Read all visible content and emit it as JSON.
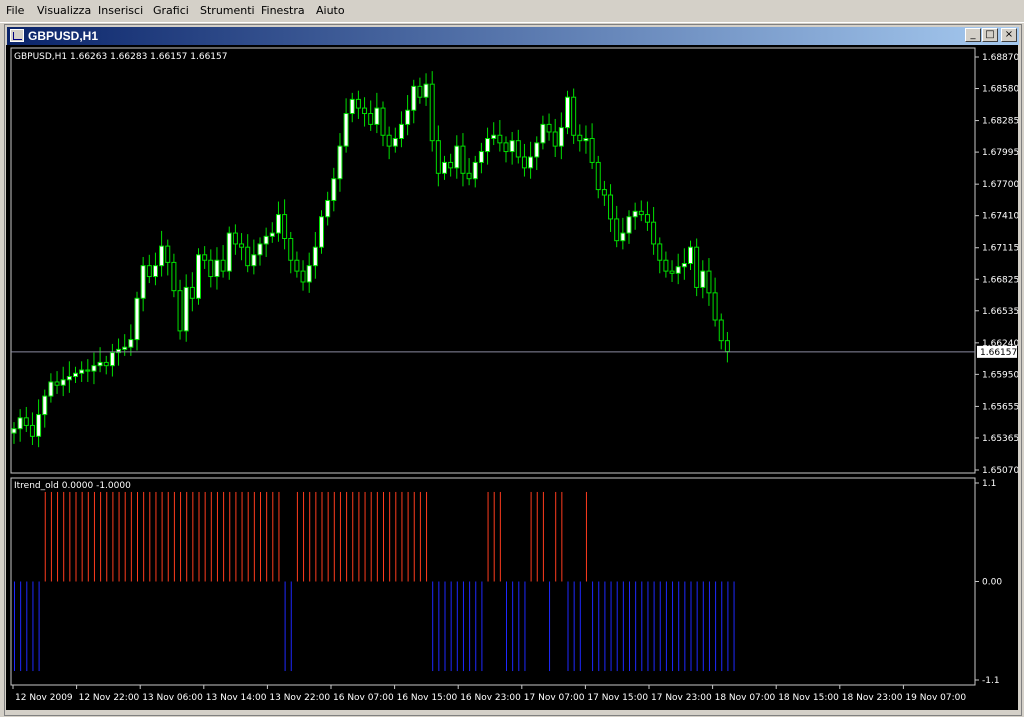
{
  "menu": {
    "items": [
      {
        "label": "File"
      },
      {
        "label": "Visualizza"
      },
      {
        "label": "Inserisci"
      },
      {
        "label": "Grafici"
      },
      {
        "label": "Strumenti"
      },
      {
        "label": "Finestra"
      },
      {
        "label": "Aiuto"
      }
    ]
  },
  "window": {
    "title": "GBPUSD,H1",
    "minimize": "_",
    "maximize": "□",
    "close": "×"
  },
  "colors": {
    "background": "#000000",
    "candle_bull": "#ffffff",
    "candle_bear": "#000000",
    "wick": "#00e000",
    "grid_line": "#c8c8c8",
    "indicator_up": "#ff3c1e",
    "indicator_down": "#1e28ff"
  },
  "chart_data": [
    {
      "type": "candlestick",
      "title": "GBPUSD,H1  1.66263 1.66283 1.66157 1.66157",
      "symbol": "GBPUSD",
      "timeframe": "H1",
      "ohlc_last": {
        "open": 1.66263,
        "high": 1.66283,
        "low": 1.66157,
        "close": 1.66157
      },
      "current_price_label": "1.66157",
      "current_price": 1.66157,
      "ylim": [
        1.6507,
        1.6887
      ],
      "y_ticks": [
        "1.68870",
        "1.68580",
        "1.68285",
        "1.67995",
        "1.67700",
        "1.67410",
        "1.67115",
        "1.66825",
        "1.66535",
        "1.66240",
        "1.65950",
        "1.65655",
        "1.65365",
        "1.65070"
      ],
      "x_ticks": [
        "12 Nov 2009",
        "12 Nov 22:00",
        "13 Nov 06:00",
        "13 Nov 14:00",
        "13 Nov 22:00",
        "16 Nov 07:00",
        "16 Nov 15:00",
        "16 Nov 23:00",
        "17 Nov 07:00",
        "17 Nov 15:00",
        "17 Nov 23:00",
        "18 Nov 07:00",
        "18 Nov 15:00",
        "18 Nov 23:00",
        "19 Nov 07:00"
      ],
      "close": [
        1.6545,
        1.6555,
        1.6548,
        1.6538,
        1.6558,
        1.6575,
        1.6588,
        1.6585,
        1.659,
        1.6593,
        1.6596,
        1.6599,
        1.6598,
        1.6603,
        1.6606,
        1.6603,
        1.6615,
        1.6618,
        1.662,
        1.6627,
        1.6665,
        1.6695,
        1.6685,
        1.6695,
        1.6713,
        1.6698,
        1.6672,
        1.6635,
        1.6675,
        1.6665,
        1.6705,
        1.67,
        1.6685,
        1.67,
        1.669,
        1.6725,
        1.6715,
        1.6712,
        1.6695,
        1.6705,
        1.6715,
        1.6722,
        1.6725,
        1.6742,
        1.672,
        1.67,
        1.669,
        1.668,
        1.6695,
        1.6712,
        1.674,
        1.6755,
        1.6775,
        1.6805,
        1.6835,
        1.6848,
        1.684,
        1.6835,
        1.6825,
        1.684,
        1.6815,
        1.6805,
        1.6812,
        1.6825,
        1.6838,
        1.686,
        1.685,
        1.6862,
        1.681,
        1.678,
        1.679,
        1.6785,
        1.6805,
        1.678,
        1.6775,
        1.679,
        1.68,
        1.6812,
        1.6815,
        1.6808,
        1.68,
        1.681,
        1.6795,
        1.6785,
        1.6795,
        1.6808,
        1.6825,
        1.6818,
        1.6805,
        1.6822,
        1.685,
        1.6815,
        1.681,
        1.6812,
        1.679,
        1.6765,
        1.676,
        1.6738,
        1.6718,
        1.6725,
        1.674,
        1.6745,
        1.6742,
        1.6735,
        1.6715,
        1.67,
        1.669,
        1.6688,
        1.6694,
        1.6697,
        1.6712,
        1.6675,
        1.669,
        1.667,
        1.6645,
        1.6626,
        1.6616
      ]
    },
    {
      "type": "bar",
      "title": "Itrend_old 0.0000 -1.0000",
      "ylim": [
        -1.1,
        1.1
      ],
      "y_ticks": [
        "1.1",
        "0.00",
        "-1.1"
      ],
      "up_bars": [
        5,
        6,
        7,
        8,
        9,
        10,
        11,
        12,
        13,
        14,
        15,
        16,
        17,
        18,
        19,
        20,
        21,
        22,
        23,
        24,
        25,
        26,
        27,
        28,
        29,
        30,
        31,
        32,
        33,
        34,
        35,
        36,
        37,
        38,
        39,
        40,
        41,
        42,
        43,
        46,
        47,
        48,
        49,
        50,
        51,
        52,
        53,
        54,
        55,
        56,
        57,
        58,
        59,
        60,
        61,
        62,
        63,
        64,
        65,
        66,
        67,
        77,
        78,
        79,
        84,
        85,
        86,
        88,
        89,
        93
      ],
      "down_bars": [
        0,
        1,
        2,
        3,
        4,
        44,
        45,
        68,
        69,
        70,
        71,
        72,
        73,
        74,
        75,
        76,
        80,
        81,
        82,
        83,
        87,
        90,
        91,
        92,
        94,
        95,
        96,
        97,
        98,
        99,
        100,
        101,
        102,
        103,
        104,
        105,
        106,
        107,
        108,
        109,
        110,
        111,
        112,
        113,
        114,
        115,
        116,
        117
      ]
    }
  ]
}
